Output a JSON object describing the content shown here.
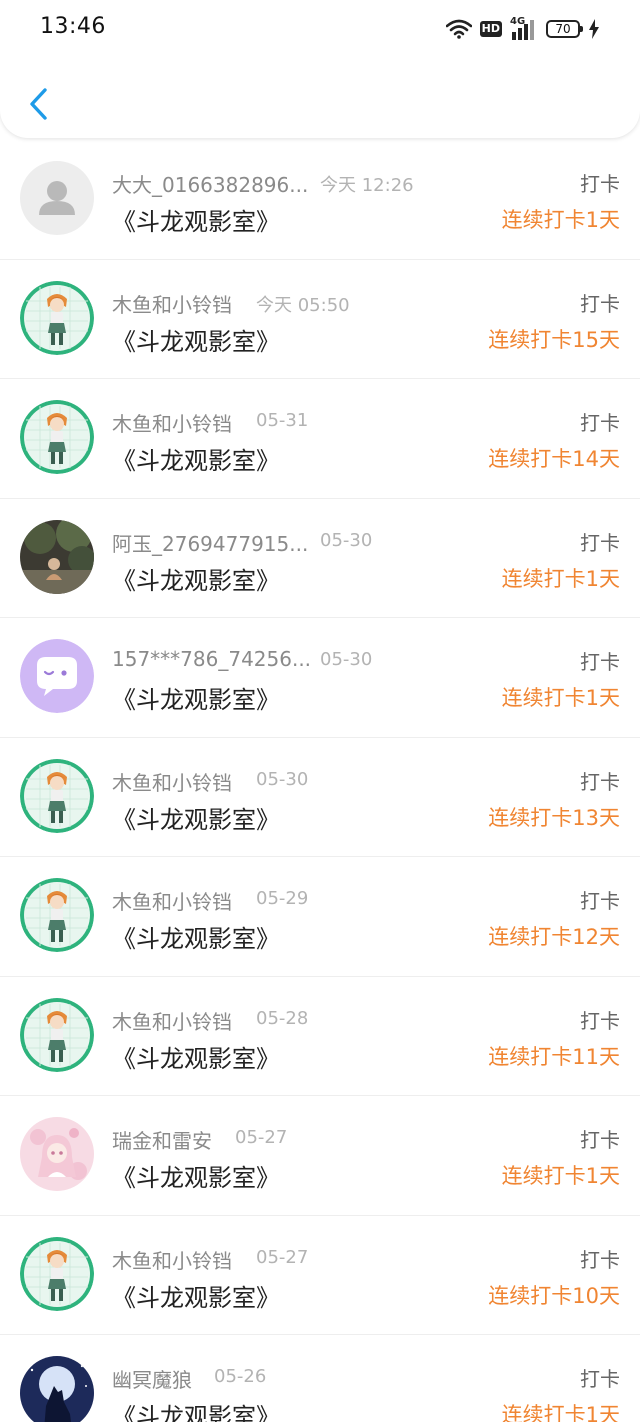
{
  "status_bar": {
    "time": "13:46",
    "hd_label": "HD",
    "network_label": "4G",
    "battery_level": "70"
  },
  "colors": {
    "accent_blue": "#1e9be8",
    "streak_orange": "#f08532",
    "name_gray": "#8a8a8a"
  },
  "items": [
    {
      "name": "大大_0166382896...",
      "time": "今天 12:26",
      "title": "《斗龙观影室》",
      "action": "打卡",
      "streak": "连续打卡1天",
      "avatar": "default-avatar-icon"
    },
    {
      "name": "木鱼和小铃铛",
      "time": "今天 05:50",
      "title": "《斗龙观影室》",
      "action": "打卡",
      "streak": "连续打卡15天",
      "avatar": "anime-girl-avatar"
    },
    {
      "name": "木鱼和小铃铛",
      "time": "05-31",
      "title": "《斗龙观影室》",
      "action": "打卡",
      "streak": "连续打卡14天",
      "avatar": "anime-girl-avatar"
    },
    {
      "name": "阿玉_2769477915...",
      "time": "05-30",
      "title": "《斗龙观影室》",
      "action": "打卡",
      "streak": "连续打卡1天",
      "avatar": "photo-avatar"
    },
    {
      "name": "157***786_74256...",
      "time": "05-30",
      "title": "《斗龙观影室》",
      "action": "打卡",
      "streak": "连续打卡1天",
      "avatar": "chat-bubble-avatar"
    },
    {
      "name": "木鱼和小铃铛",
      "time": "05-30",
      "title": "《斗龙观影室》",
      "action": "打卡",
      "streak": "连续打卡13天",
      "avatar": "anime-girl-avatar"
    },
    {
      "name": "木鱼和小铃铛",
      "time": "05-29",
      "title": "《斗龙观影室》",
      "action": "打卡",
      "streak": "连续打卡12天",
      "avatar": "anime-girl-avatar"
    },
    {
      "name": "木鱼和小铃铛",
      "time": "05-28",
      "title": "《斗龙观影室》",
      "action": "打卡",
      "streak": "连续打卡11天",
      "avatar": "anime-girl-avatar"
    },
    {
      "name": "瑞金和雷安",
      "time": "05-27",
      "title": "《斗龙观影室》",
      "action": "打卡",
      "streak": "连续打卡1天",
      "avatar": "pink-anime-avatar"
    },
    {
      "name": "木鱼和小铃铛",
      "time": "05-27",
      "title": "《斗龙观影室》",
      "action": "打卡",
      "streak": "连续打卡10天",
      "avatar": "anime-girl-avatar"
    },
    {
      "name": "幽冥魔狼",
      "time": "05-26",
      "title": "《斗龙观影室》",
      "action": "打卡",
      "streak": "连续打卡1天",
      "avatar": "wolf-moon-avatar"
    }
  ]
}
